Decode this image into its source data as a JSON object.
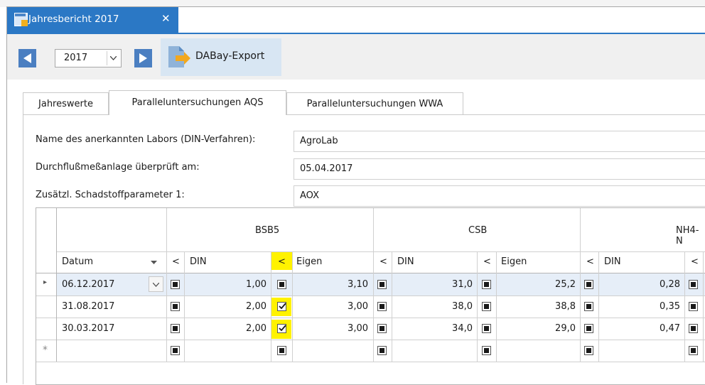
{
  "doc_tab": {
    "title": "Jahresbericht 2017",
    "close": "✕"
  },
  "toolbar": {
    "year": "2017",
    "export_label": "DABay-Export"
  },
  "tabs": [
    {
      "label": "Jahreswerte"
    },
    {
      "label": "Paralleluntersuchungen AQS"
    },
    {
      "label": "Paralleluntersuchungen WWA"
    }
  ],
  "fields": {
    "labor_label": "Name des anerkannten Labors (DIN-Verfahren):",
    "labor_value": "AgroLab",
    "durchfluss_label": "Durchflußmeßanlage überprüft am:",
    "durchfluss_value": "05.04.2017",
    "param_label": "Zusätzl. Schadstoffparameter 1:",
    "param_value": "AOX"
  },
  "grid": {
    "groups": [
      "BSB5",
      "CSB",
      "NH4-N"
    ],
    "headers": {
      "datum": "Datum",
      "lt": "<",
      "din": "DIN",
      "eigen": "Eigen"
    },
    "rows": [
      {
        "datum": "06.12.2017",
        "bsb_din": "1,00",
        "bsb_eigen": "3,10",
        "csb_din": "31,0",
        "csb_eigen": "25,2",
        "nh4_din": "0,28",
        "bsb_eigen_lt_checked": false
      },
      {
        "datum": "31.08.2017",
        "bsb_din": "2,00",
        "bsb_eigen": "3,00",
        "csb_din": "38,0",
        "csb_eigen": "38,8",
        "nh4_din": "0,35",
        "bsb_eigen_lt_checked": true
      },
      {
        "datum": "30.03.2017",
        "bsb_din": "2,00",
        "bsb_eigen": "3,00",
        "csb_din": "34,0",
        "csb_eigen": "29,0",
        "nh4_din": "0,47",
        "bsb_eigen_lt_checked": true
      }
    ],
    "new_row_marker": "*",
    "current_row_marker": "▸"
  },
  "colors": {
    "accent": "#2b78c5",
    "highlight": "#fff200",
    "selected_row": "#e6eef8"
  }
}
